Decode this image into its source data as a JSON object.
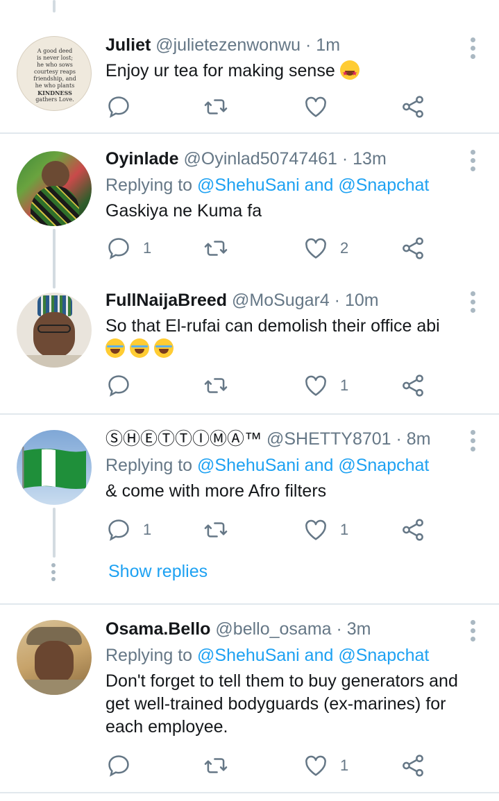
{
  "tweets": [
    {
      "name": "Juliet",
      "handle": "@julietezenwonwu · 1m",
      "text": "Enjoy ur tea for making sense",
      "avatar_text": [
        "A good deed",
        "is never lost;",
        "he who sows",
        "courtesy reaps",
        "friendship, and",
        "he who plants",
        "KINDNESS",
        "gathers Love."
      ]
    },
    {
      "name": "Oyinlade",
      "handle": "@Oyinlad50747461 · 13m",
      "replying_prefix": "Replying to",
      "replying_mentions": "@ShehuSani and @Snapchat",
      "text": "Gaskiya ne Kuma fa",
      "reply_count": "1",
      "like_count": "2"
    },
    {
      "name": "FullNaijaBreed",
      "handle": "@MoSugar4 · 10m",
      "text": "So that El-rufai can demolish their office abi",
      "like_count": "1"
    },
    {
      "name": "ⓈⒽⒺⓉⓉⒾⓂⒶ™",
      "handle": "@SHETTY8701 · 8m",
      "replying_prefix": "Replying to",
      "replying_mentions": "@ShehuSani and @Snapchat",
      "text": "& come with more Afro filters",
      "reply_count": "1",
      "like_count": "1",
      "show_replies": "Show replies"
    },
    {
      "name": "Osama.Bello",
      "handle": "@bello_osama · 3m",
      "replying_prefix": "Replying to",
      "replying_mentions": "@ShehuSani and @Snapchat",
      "text": "Don't forget to tell them to buy generators and get well-trained bodyguards (ex-marines) for each employee.",
      "like_count": "1"
    }
  ],
  "colors": {
    "link": "#1da1f2",
    "secondary": "#657786",
    "divider": "#e1e8ed",
    "icon": "#657786"
  },
  "icons": [
    "reply-icon",
    "retweet-icon",
    "like-icon",
    "share-icon",
    "more-options-icon"
  ]
}
